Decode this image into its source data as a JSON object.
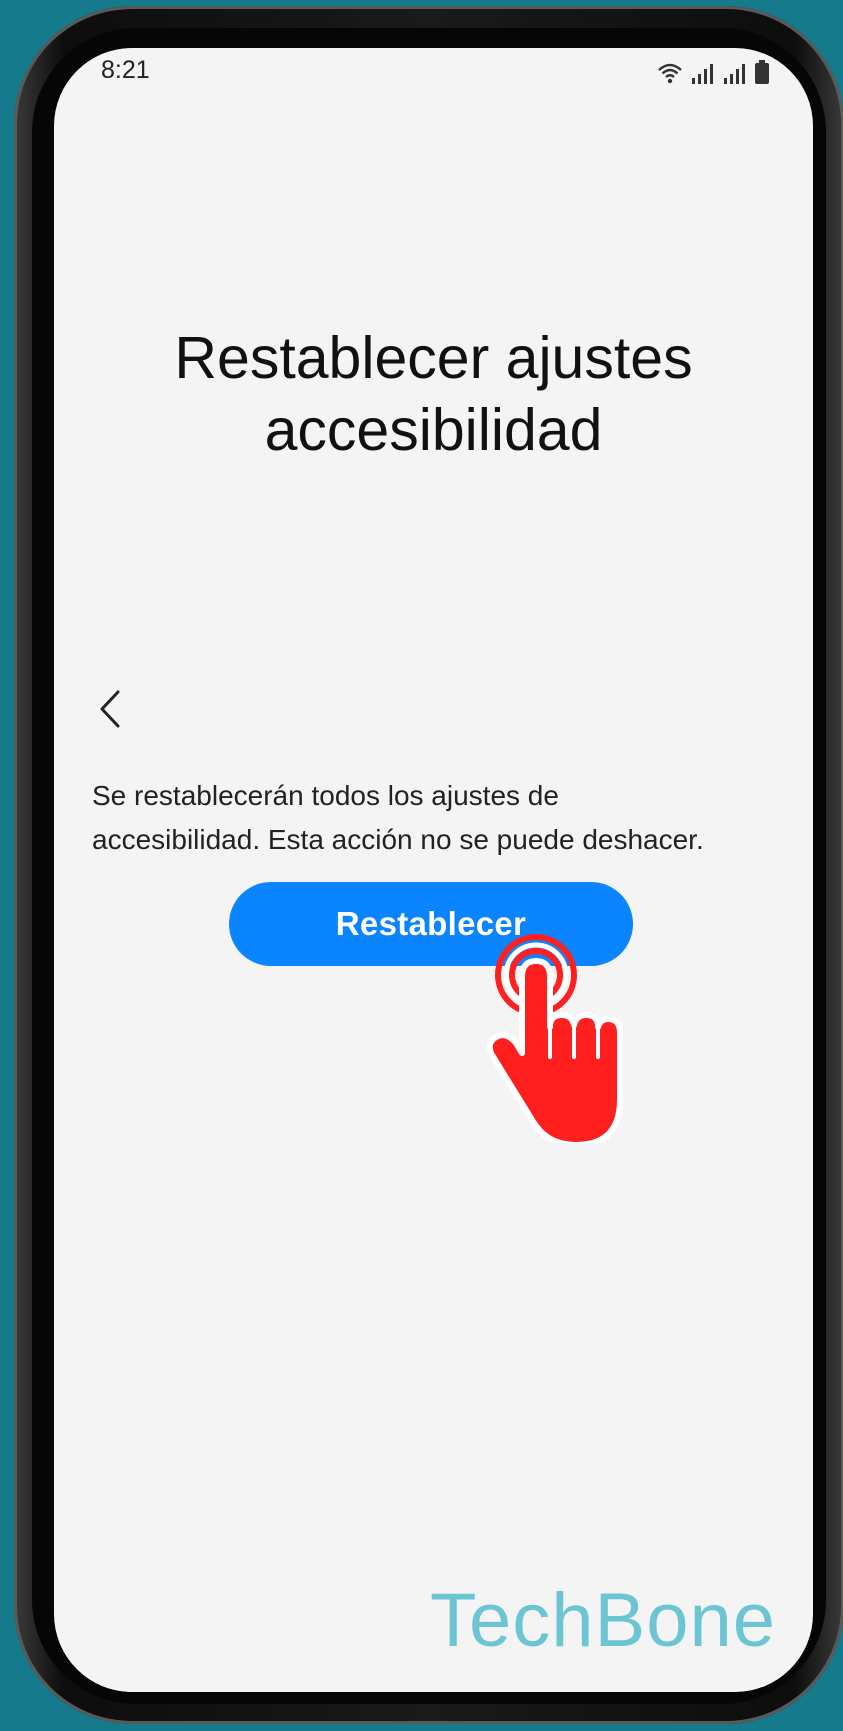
{
  "status_bar": {
    "time": "8:21",
    "icons": [
      "wifi-icon",
      "signal-1-icon",
      "signal-2-icon",
      "battery-icon"
    ]
  },
  "page": {
    "title_line1": "Restablecer ajustes",
    "title_line2": "accesibilidad",
    "back_icon": "chevron-left-icon",
    "description_line1": "Se restablecerán todos los ajustes de",
    "description_line2": "accesibilidad. Esta acción no se puede deshacer.",
    "reset_button_label": "Restablecer"
  },
  "overlay": {
    "tap_indicator": "tap-hand-icon",
    "watermark": "TechBone"
  },
  "colors": {
    "background": "#157a8c",
    "screen": "#f4f4f4",
    "accent": "#0a84ff",
    "tap_indicator": "#ff1f1f",
    "watermark": "#6cc5d2"
  }
}
